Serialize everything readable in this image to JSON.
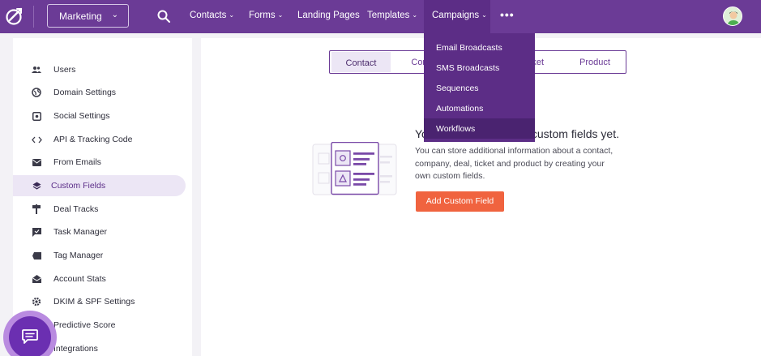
{
  "topbar": {
    "workspace": "Marketing",
    "nav": [
      {
        "label": "Contacts",
        "caret": true
      },
      {
        "label": "Forms",
        "caret": true
      },
      {
        "label": "Landing Pages",
        "caret": false
      },
      {
        "label": "Templates",
        "caret": true
      },
      {
        "label": "Campaigns",
        "caret": true
      }
    ],
    "more": "•••",
    "accent": "#6b3b96"
  },
  "dropdown": {
    "items": [
      "Email Broadcasts",
      "SMS Broadcasts",
      "Sequences",
      "Automations",
      "Workflows"
    ],
    "hovered": "Workflows"
  },
  "sidebar": {
    "items": [
      {
        "label": "Users",
        "icon": "users-icon"
      },
      {
        "label": "Domain Settings",
        "icon": "globe-icon"
      },
      {
        "label": "Social Settings",
        "icon": "share-icon"
      },
      {
        "label": "API & Tracking Code",
        "icon": "code-icon"
      },
      {
        "label": "From Emails",
        "icon": "envelope-icon"
      },
      {
        "label": "Custom Fields",
        "icon": "layers-icon"
      },
      {
        "label": "Deal Tracks",
        "icon": "signpost-icon"
      },
      {
        "label": "Task Manager",
        "icon": "task-icon"
      },
      {
        "label": "Tag Manager",
        "icon": "tag-icon"
      },
      {
        "label": "Account Stats",
        "icon": "inbox-icon"
      },
      {
        "label": "DKIM & SPF Settings",
        "icon": "gear-icon"
      },
      {
        "label": "Predictive Score",
        "icon": "score-icon"
      },
      {
        "label": "Integrations",
        "icon": "plug-icon"
      }
    ],
    "active": "Custom Fields"
  },
  "main": {
    "tabs": [
      "Contact",
      "Com",
      "cket",
      "Product"
    ],
    "active_tab": "Contact",
    "empty_title_left": "Yo",
    "empty_title_right": "custom fields yet.",
    "empty_desc": "You can store additional information about a contact, company, deal, ticket and product by creating your own custom fields.",
    "add_button": "Add Custom Field",
    "button_color": "#f0633f"
  }
}
